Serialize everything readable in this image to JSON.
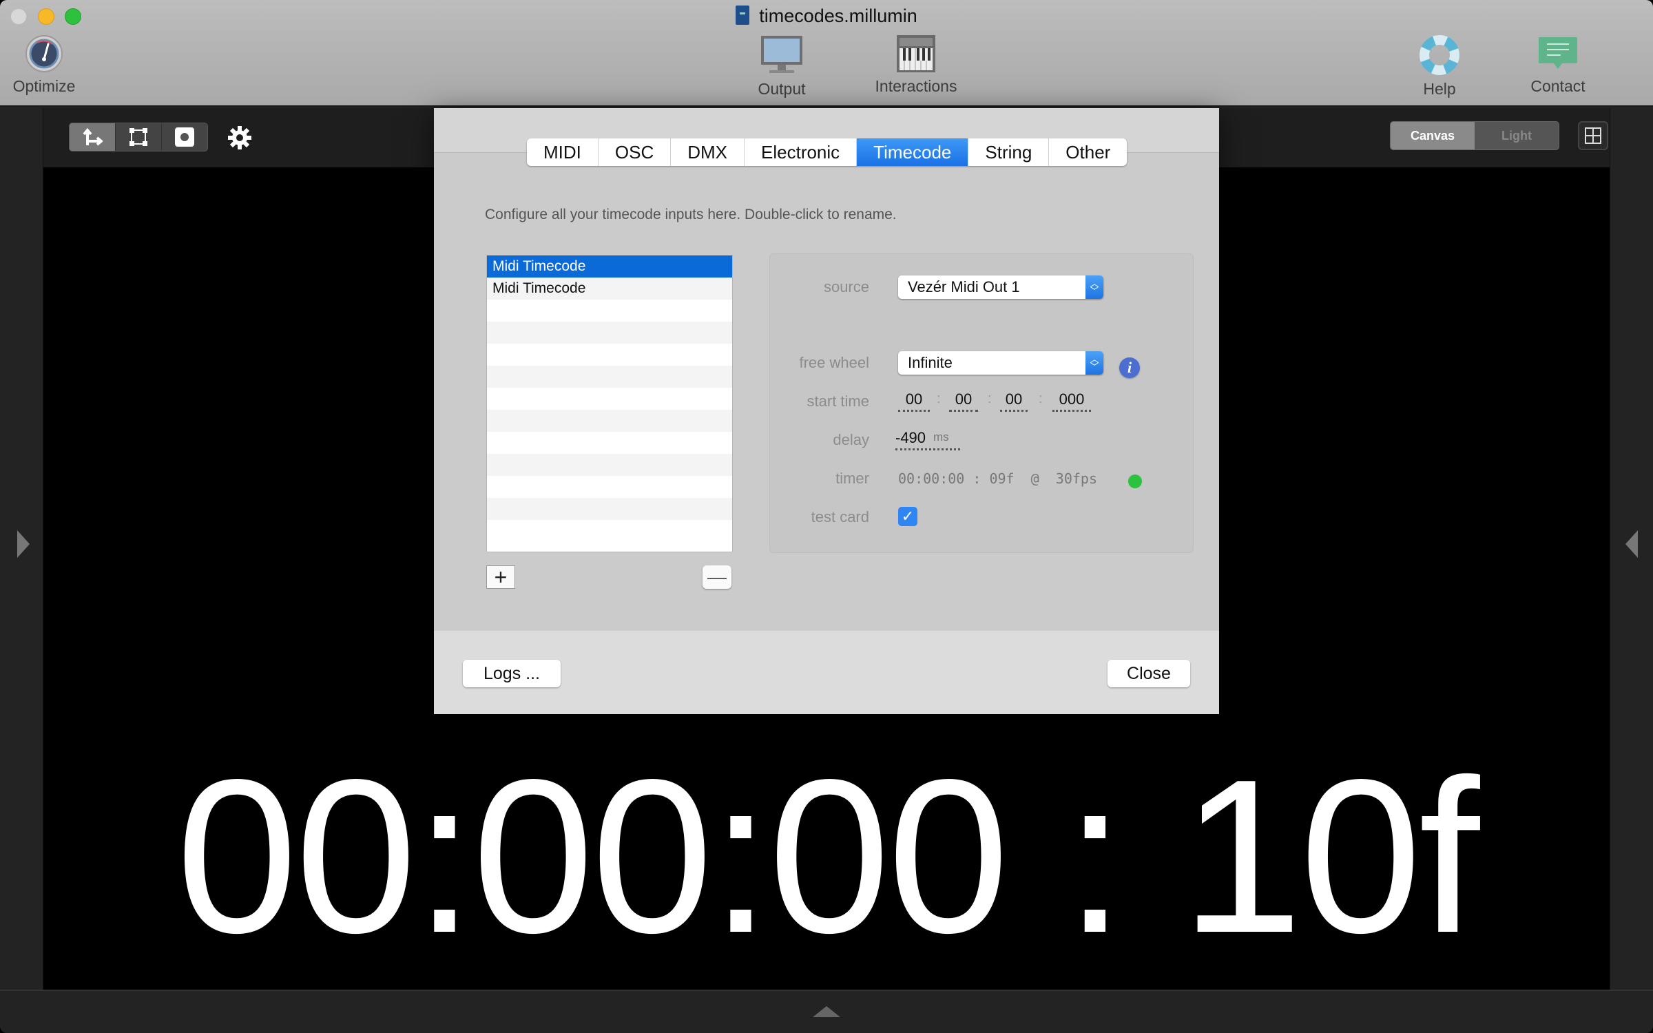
{
  "window": {
    "title": "timecodes.millumin",
    "toolbar": {
      "optimize": "Optimize",
      "output": "Output",
      "interactions": "Interactions",
      "help": "Help",
      "contact": "Contact"
    }
  },
  "canvas_toolbar": {
    "view_modes": [
      "Canvas",
      "Light"
    ],
    "active_view": "Canvas"
  },
  "canvas": {
    "timecode_display": "00:00:00 : 10f"
  },
  "dialog": {
    "tabs": [
      "MIDI",
      "OSC",
      "DMX",
      "Electronic",
      "Timecode",
      "String",
      "Other"
    ],
    "active_tab": "Timecode",
    "hint": "Configure all your timecode inputs here. Double-click to rename.",
    "inputs": [
      {
        "name": "Midi Timecode",
        "selected": true
      },
      {
        "name": "Midi Timecode",
        "selected": false
      }
    ],
    "add_label": "+",
    "remove_label": "—",
    "settings": {
      "source_label": "source",
      "source_value": "Vezér Midi Out 1",
      "free_wheel_label": "free wheel",
      "free_wheel_value": "Infinite",
      "info_label": "i",
      "start_time_label": "start time",
      "start_time": {
        "hours": "00",
        "minutes": "00",
        "seconds": "00",
        "milliseconds": "000"
      },
      "start_time_separator": ":",
      "delay_label": "delay",
      "delay_value": "-490",
      "delay_unit": "ms",
      "timer_label": "timer",
      "timer_value": "00:00:00 : 09f  @  30fps",
      "timer_status_color": "#2bc23f",
      "test_card_label": "test card",
      "test_card_checked": true,
      "check_glyph": "✓"
    },
    "logs_button": "Logs ...",
    "close_button": "Close"
  },
  "colors": {
    "accent": "#1a72e6",
    "selection": "#0a6ad8"
  }
}
